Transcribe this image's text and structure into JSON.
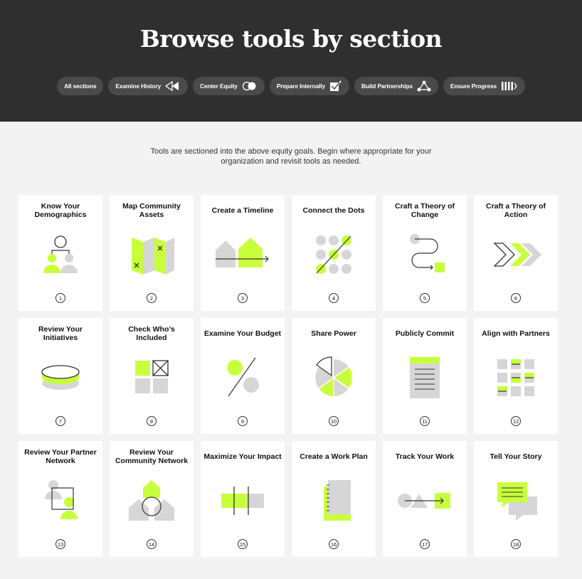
{
  "page": {
    "title": "Browse tools by section",
    "intro": "Tools are sectioned into the above equity goals. Begin where appropriate for your organization and revisit tools as needed."
  },
  "filters": [
    {
      "label": "All sections",
      "icon": ""
    },
    {
      "label": "Examine History",
      "icon": "rewind-icon"
    },
    {
      "label": "Center Equity",
      "icon": "toggle-icon"
    },
    {
      "label": "Prepare Internally",
      "icon": "checkbox-icon"
    },
    {
      "label": "Build Partnerships",
      "icon": "network-icon"
    },
    {
      "label": "Ensure Progress",
      "icon": "progress-icon"
    }
  ],
  "colors": {
    "accent": "#c8ff3c",
    "gray": "#d6d6d6",
    "dark": "#2f2f2f"
  },
  "tools": [
    {
      "title": "Know Your Demographics",
      "number": "1",
      "icon": "people-icon"
    },
    {
      "title": "Map Community Assets",
      "number": "2",
      "icon": "map-icon"
    },
    {
      "title": "Create a Timeline",
      "number": "3",
      "icon": "timeline-icon"
    },
    {
      "title": "Connect the Dots",
      "number": "4",
      "icon": "dots-icon"
    },
    {
      "title": "Craft a Theory of Change",
      "number": "5",
      "icon": "path-icon"
    },
    {
      "title": "Craft a Theory of Action",
      "number": "6",
      "icon": "chevrons-icon"
    },
    {
      "title": "Review Your Initiatives",
      "number": "7",
      "icon": "disc-icon"
    },
    {
      "title": "Check Who’s Included",
      "number": "8",
      "icon": "squares-icon"
    },
    {
      "title": "Examine Your Budget",
      "number": "9",
      "icon": "percent-icon"
    },
    {
      "title": "Share Power",
      "number": "10",
      "icon": "pie-icon"
    },
    {
      "title": "Publicly Commit",
      "number": "11",
      "icon": "document-icon"
    },
    {
      "title": "Align with Partners",
      "number": "12",
      "icon": "grid-icon"
    },
    {
      "title": "Review Your Partner Network",
      "number": "13",
      "icon": "partner-icon"
    },
    {
      "title": "Review Your Community Network",
      "number": "14",
      "icon": "houses-icon"
    },
    {
      "title": "Maximize Your Impact",
      "number": "15",
      "icon": "bar-icon"
    },
    {
      "title": "Create a Work Plan",
      "number": "16",
      "icon": "notebook-icon"
    },
    {
      "title": "Track Your Work",
      "number": "17",
      "icon": "shapes-icon"
    },
    {
      "title": "Tell Your Story",
      "number": "18",
      "icon": "speech-icon"
    }
  ]
}
